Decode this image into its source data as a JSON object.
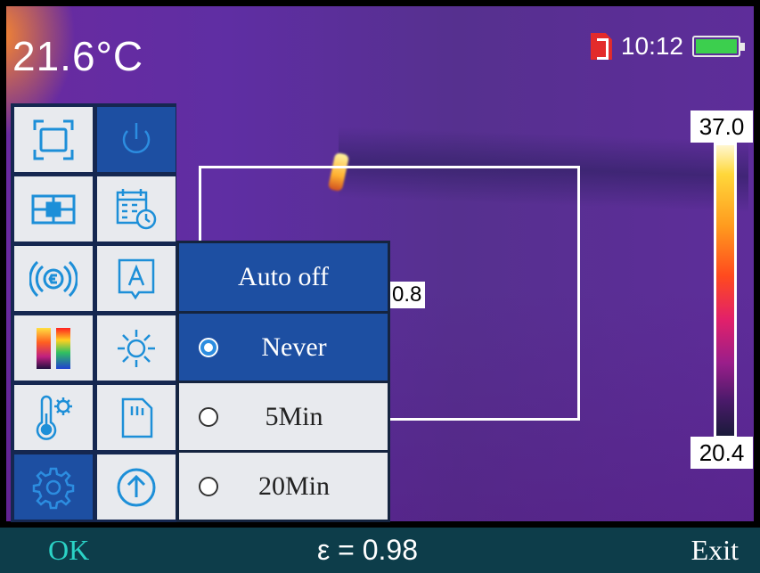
{
  "header": {
    "temperature": "21.6°C",
    "clock": "10:12",
    "icons": {
      "storage": "sd-card-icon",
      "battery": "battery-icon"
    },
    "battery_level": 1.0
  },
  "image": {
    "center_value": "0.8",
    "scale_max": "37.0",
    "scale_min": "20.4"
  },
  "menu": {
    "items": [
      {
        "name": "area-measure-icon",
        "active": false
      },
      {
        "name": "power-icon",
        "active": true
      },
      {
        "name": "center-measure-icon",
        "active": false
      },
      {
        "name": "date-time-icon",
        "active": false
      },
      {
        "name": "emissivity-icon",
        "active": false
      },
      {
        "name": "language-icon",
        "active": false
      },
      {
        "name": "palette-icon",
        "active": false
      },
      {
        "name": "brightness-icon",
        "active": false
      },
      {
        "name": "temperature-settings-icon",
        "active": false
      },
      {
        "name": "sd-storage-icon",
        "active": false
      },
      {
        "name": "settings-gear-icon",
        "active": true
      },
      {
        "name": "upgrade-icon",
        "active": false
      }
    ]
  },
  "popup": {
    "title": "Auto off",
    "options": [
      {
        "label": "Never",
        "selected": true
      },
      {
        "label": "5Min",
        "selected": false
      },
      {
        "label": "20Min",
        "selected": false
      }
    ]
  },
  "footer": {
    "ok_label": "OK",
    "emissivity": "ε = 0.98",
    "exit_label": "Exit"
  },
  "colors": {
    "accent": "#1d4fa2",
    "footer_bg": "#0d3d4a",
    "ok_color": "#2bd3c6"
  }
}
